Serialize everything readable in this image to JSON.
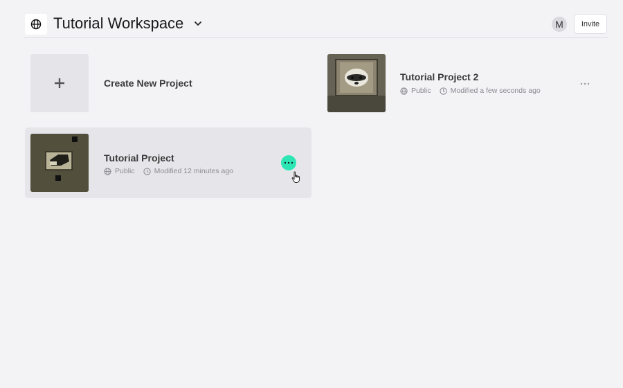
{
  "header": {
    "workspace_title": "Tutorial Workspace",
    "avatar_initial": "M",
    "invite_label": "Invite"
  },
  "create": {
    "label": "Create New Project",
    "icon": "plus-icon"
  },
  "projects": [
    {
      "title": "Tutorial Project 2",
      "visibility": "Public",
      "modified": "Modified a few seconds ago"
    },
    {
      "title": "Tutorial Project",
      "visibility": "Public",
      "modified": "Modified 12 minutes ago"
    }
  ],
  "colors": {
    "accent": "#2ee6b5",
    "background": "#f3f3f6",
    "hover_card": "#e6e6ea"
  }
}
